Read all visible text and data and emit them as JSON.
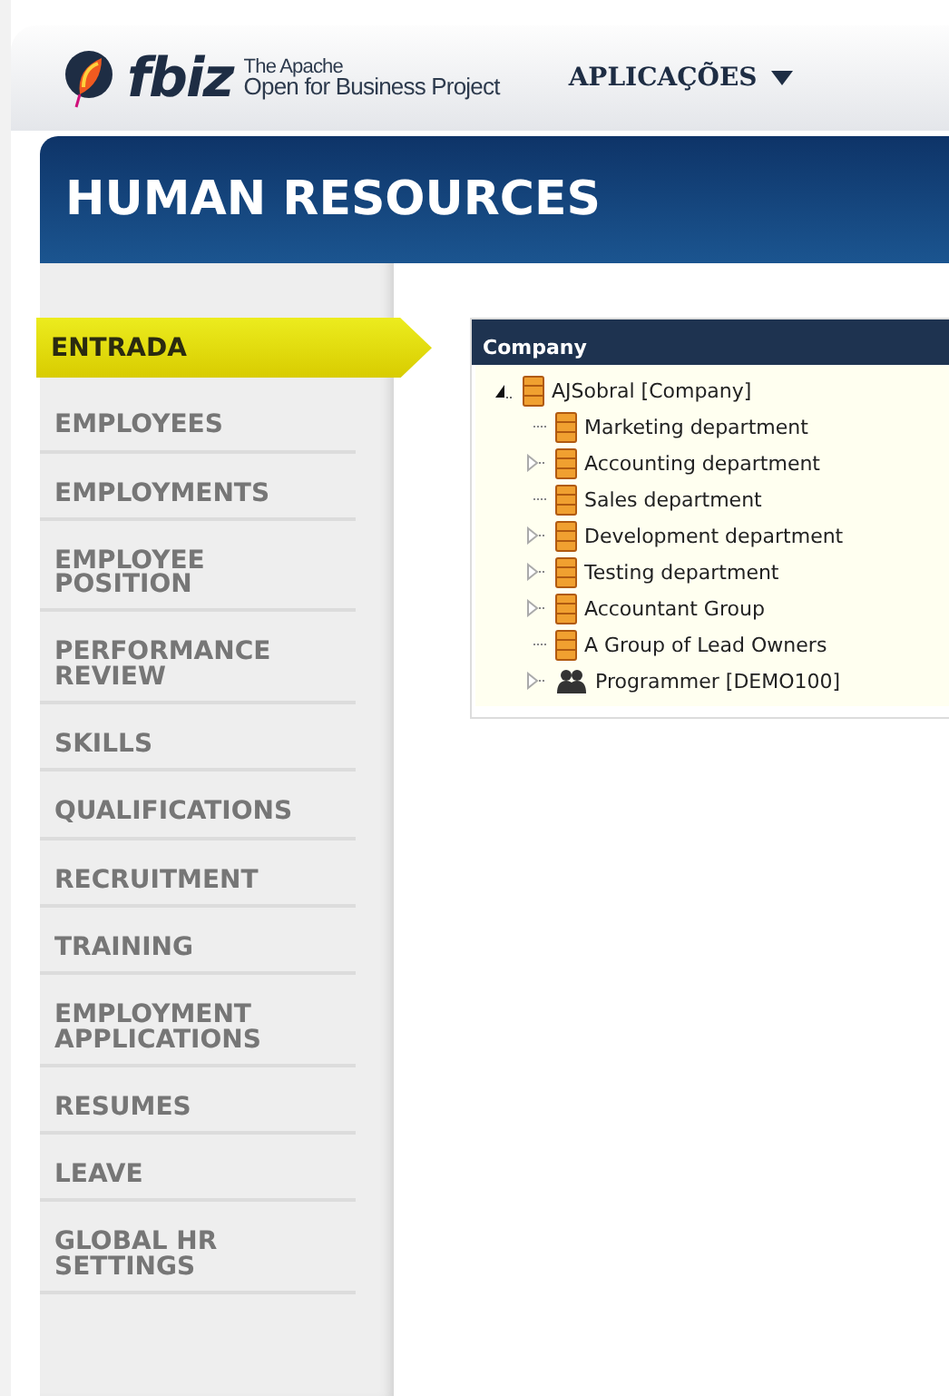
{
  "header": {
    "logo": {
      "wordmark": "fbiz",
      "tagline_top": "The Apache",
      "tagline_bottom": "Open for Business Project"
    },
    "menu": {
      "label": "APLICAÇÕES"
    }
  },
  "banner": {
    "title": "HUMAN RESOURCES"
  },
  "sidebar": {
    "items": [
      {
        "label": "ENTRADA",
        "selected": true
      },
      {
        "label": "EMPLOYEES",
        "selected": false
      },
      {
        "label": "EMPLOYMENTS",
        "selected": false
      },
      {
        "label": "EMPLOYEE POSITION",
        "selected": false
      },
      {
        "label": "PERFORMANCE REVIEW",
        "selected": false
      },
      {
        "label": "SKILLS",
        "selected": false
      },
      {
        "label": "QUALIFICATIONS",
        "selected": false
      },
      {
        "label": "RECRUITMENT",
        "selected": false
      },
      {
        "label": "TRAINING",
        "selected": false
      },
      {
        "label": "EMPLOYMENT APPLICATIONS",
        "selected": false
      },
      {
        "label": "RESUMES",
        "selected": false
      },
      {
        "label": "LEAVE",
        "selected": false
      },
      {
        "label": "GLOBAL HR SETTINGS",
        "selected": false
      }
    ]
  },
  "company_panel": {
    "title": "Company",
    "tree": {
      "label": "AJSobral [Company]",
      "kind": "org",
      "expanded": true,
      "children": [
        {
          "label": "Marketing department",
          "kind": "org",
          "expandable": false
        },
        {
          "label": "Accounting department",
          "kind": "org",
          "expandable": true
        },
        {
          "label": "Sales department",
          "kind": "org",
          "expandable": false
        },
        {
          "label": "Development department",
          "kind": "org",
          "expandable": true
        },
        {
          "label": "Testing department",
          "kind": "org",
          "expandable": true
        },
        {
          "label": "Accountant Group",
          "kind": "org",
          "expandable": true
        },
        {
          "label": "A Group of Lead Owners",
          "kind": "org",
          "expandable": false
        },
        {
          "label": "Programmer [DEMO100]",
          "kind": "people",
          "expandable": true
        }
      ]
    }
  }
}
